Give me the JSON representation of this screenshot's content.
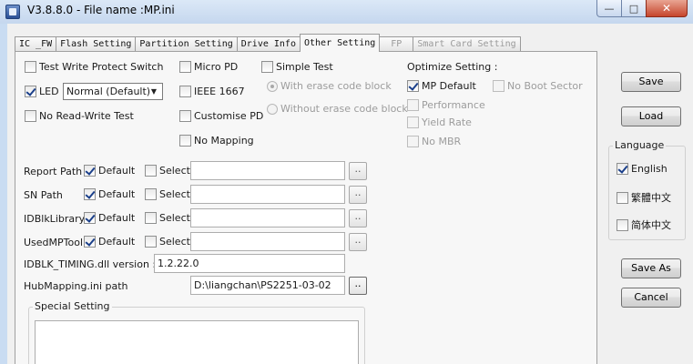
{
  "window": {
    "title": "V3.8.8.0 - File name :MP.ini",
    "minimize_glyph": "—",
    "maximize_glyph": "□",
    "close_glyph": "✕"
  },
  "tabs": [
    {
      "label": "IC _FW",
      "active": false,
      "disabled": false
    },
    {
      "label": "Flash Setting",
      "active": false,
      "disabled": false
    },
    {
      "label": "Partition Setting",
      "active": false,
      "disabled": false
    },
    {
      "label": "Drive Info",
      "active": false,
      "disabled": false
    },
    {
      "label": "Other Setting",
      "active": true,
      "disabled": false
    },
    {
      "label": "FP",
      "active": false,
      "disabled": true
    },
    {
      "label": "Smart Card Setting",
      "active": false,
      "disabled": true
    }
  ],
  "options": {
    "test_write_protect_switch": {
      "label": "Test Write Protect Switch",
      "checked": false
    },
    "led": {
      "label": "LED",
      "checked": true
    },
    "led_mode": {
      "value": "Normal (Default)"
    },
    "no_read_write_test": {
      "label": "No Read-Write Test",
      "checked": false
    },
    "micro_pd": {
      "label": "Micro PD",
      "checked": false
    },
    "ieee_1667": {
      "label": "IEEE 1667",
      "checked": false
    },
    "customise_pd": {
      "label": "Customise PD",
      "checked": false
    },
    "no_mapping": {
      "label": "No Mapping",
      "checked": false
    },
    "simple_test": {
      "label": "Simple Test",
      "checked": false
    },
    "with_erase_code_block": {
      "label": "With erase code block",
      "selected": true
    },
    "without_erase_code_block": {
      "label": "Without erase code block",
      "selected": false
    }
  },
  "optimize": {
    "title": "Optimize Setting :",
    "mp_default": {
      "label": "MP Default",
      "checked": true
    },
    "performance": {
      "label": "Performance",
      "checked": false
    },
    "yield_rate": {
      "label": "Yield Rate",
      "checked": false
    },
    "no_mbr": {
      "label": "No MBR",
      "checked": false
    },
    "no_boot_sector": {
      "label": "No Boot Sector",
      "checked": false
    }
  },
  "paths": {
    "default_label": "Default",
    "select_label": "Select",
    "browse_label": "..",
    "rows": [
      {
        "label": "Report Path :",
        "default": true,
        "select": false,
        "value": ""
      },
      {
        "label": "SN Path",
        "default": true,
        "select": false,
        "value": ""
      },
      {
        "label": "IDBlkLibrary:",
        "default": true,
        "select": false,
        "value": ""
      },
      {
        "label": "UsedMPTool:",
        "default": true,
        "select": false,
        "value": ""
      }
    ],
    "idblk_timing_label": "IDBLK_TIMING.dll version :",
    "idblk_timing_value": "1.2.22.0",
    "hubmapping_label": "HubMapping.ini path",
    "hubmapping_value": "D:\\liangchan\\PS2251-03-02"
  },
  "special_setting": {
    "title": "Special Setting"
  },
  "buttons": {
    "save": "Save",
    "load": "Load",
    "save_as": "Save As",
    "cancel": "Cancel"
  },
  "language": {
    "title": "Language",
    "options": [
      {
        "label": "English",
        "checked": true
      },
      {
        "label": "繁體中文",
        "checked": false
      },
      {
        "label": "简体中文",
        "checked": false
      }
    ]
  }
}
